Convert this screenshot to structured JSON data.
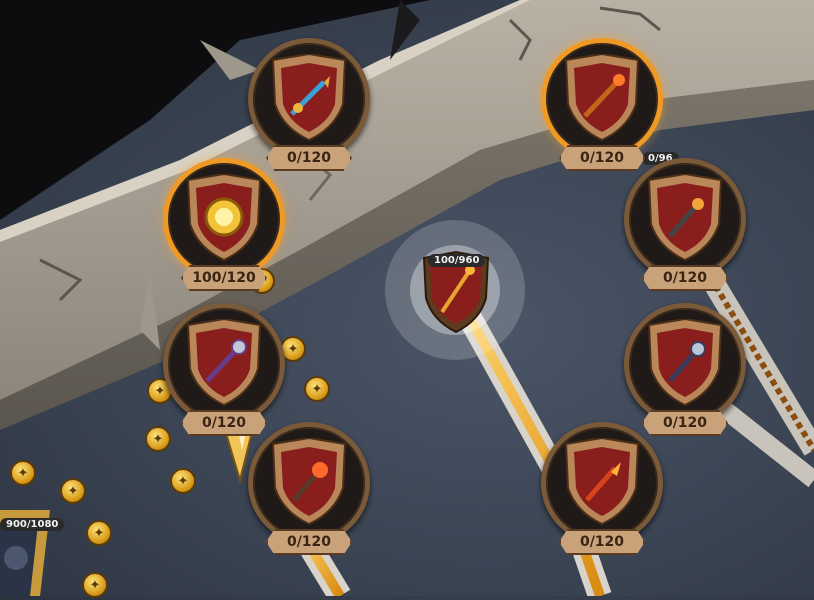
{
  "center_node": {
    "label": "100/960"
  },
  "partial_label": "0/96",
  "hero_label": "900/1080",
  "nodes": [
    {
      "id": "n1",
      "label": "0/120",
      "item": "spear-icon",
      "active": false
    },
    {
      "id": "n2",
      "label": "0/120",
      "item": "staff-icon",
      "active": true
    },
    {
      "id": "n3",
      "label": "100/120",
      "item": "gold-orb-icon",
      "active": true
    },
    {
      "id": "n4",
      "label": "0/120",
      "item": "mace-icon",
      "active": false
    },
    {
      "id": "n5",
      "label": "0/120",
      "item": "trident-icon",
      "active": false
    },
    {
      "id": "n6",
      "label": "0/120",
      "item": "scepter-icon",
      "active": false
    },
    {
      "id": "n7",
      "label": "0/120",
      "item": "flame-staff-icon",
      "active": false
    },
    {
      "id": "n8",
      "label": "0/120",
      "item": "fire-wand-icon",
      "active": false
    }
  ],
  "colors": {
    "ring_default": "#7b5a3a",
    "ring_active": "#f09a26",
    "shield_red": "#8a1e1c",
    "label_bg": "#caa27a"
  }
}
